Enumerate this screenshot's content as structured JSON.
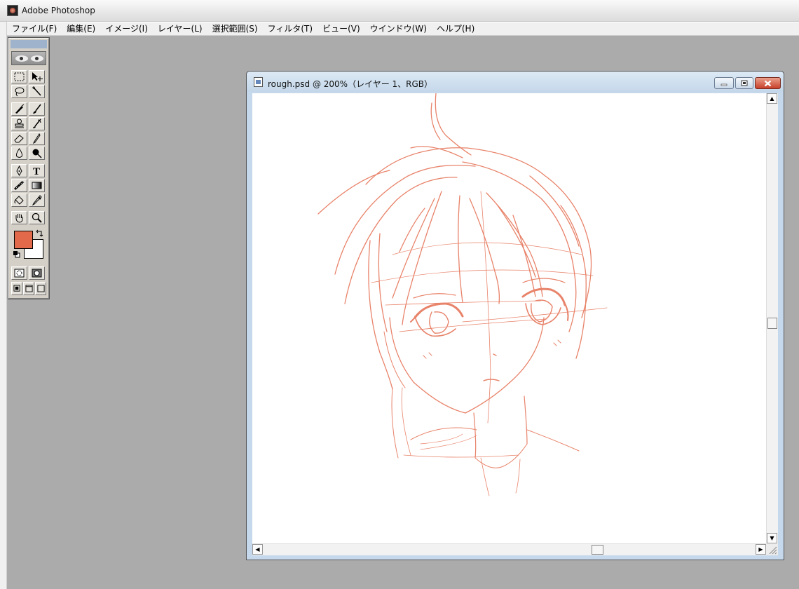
{
  "app": {
    "title": "Adobe Photoshop",
    "icon": "photoshop-eye-icon"
  },
  "menu": [
    "ファイル(F)",
    "編集(E)",
    "イメージ(I)",
    "レイヤー(L)",
    "選択範囲(S)",
    "フィルタ(T)",
    "ビュー(V)",
    "ウインドウ(W)",
    "ヘルプ(H)"
  ],
  "toolbox": {
    "tools": [
      "marquee-icon",
      "move-icon",
      "lasso-icon",
      "magic-wand-icon",
      "airbrush-icon",
      "paintbrush-icon",
      "rubber-stamp-icon",
      "history-brush-icon",
      "eraser-icon",
      "pencil-icon",
      "blur-icon",
      "burn-icon",
      "pen-icon",
      "type-icon",
      "measure-icon",
      "gradient-icon",
      "paint-bucket-icon",
      "eyedropper-icon",
      "hand-icon",
      "zoom-icon"
    ],
    "foreground_color": "#e26a4a",
    "background_color": "#ffffff"
  },
  "document": {
    "title": "rough.psd @ 200%（レイヤー 1、RGB）",
    "sketch_color": "#e8836a",
    "vertical_scroll_position": 0.5,
    "horizontal_scroll_position": 0.69
  }
}
